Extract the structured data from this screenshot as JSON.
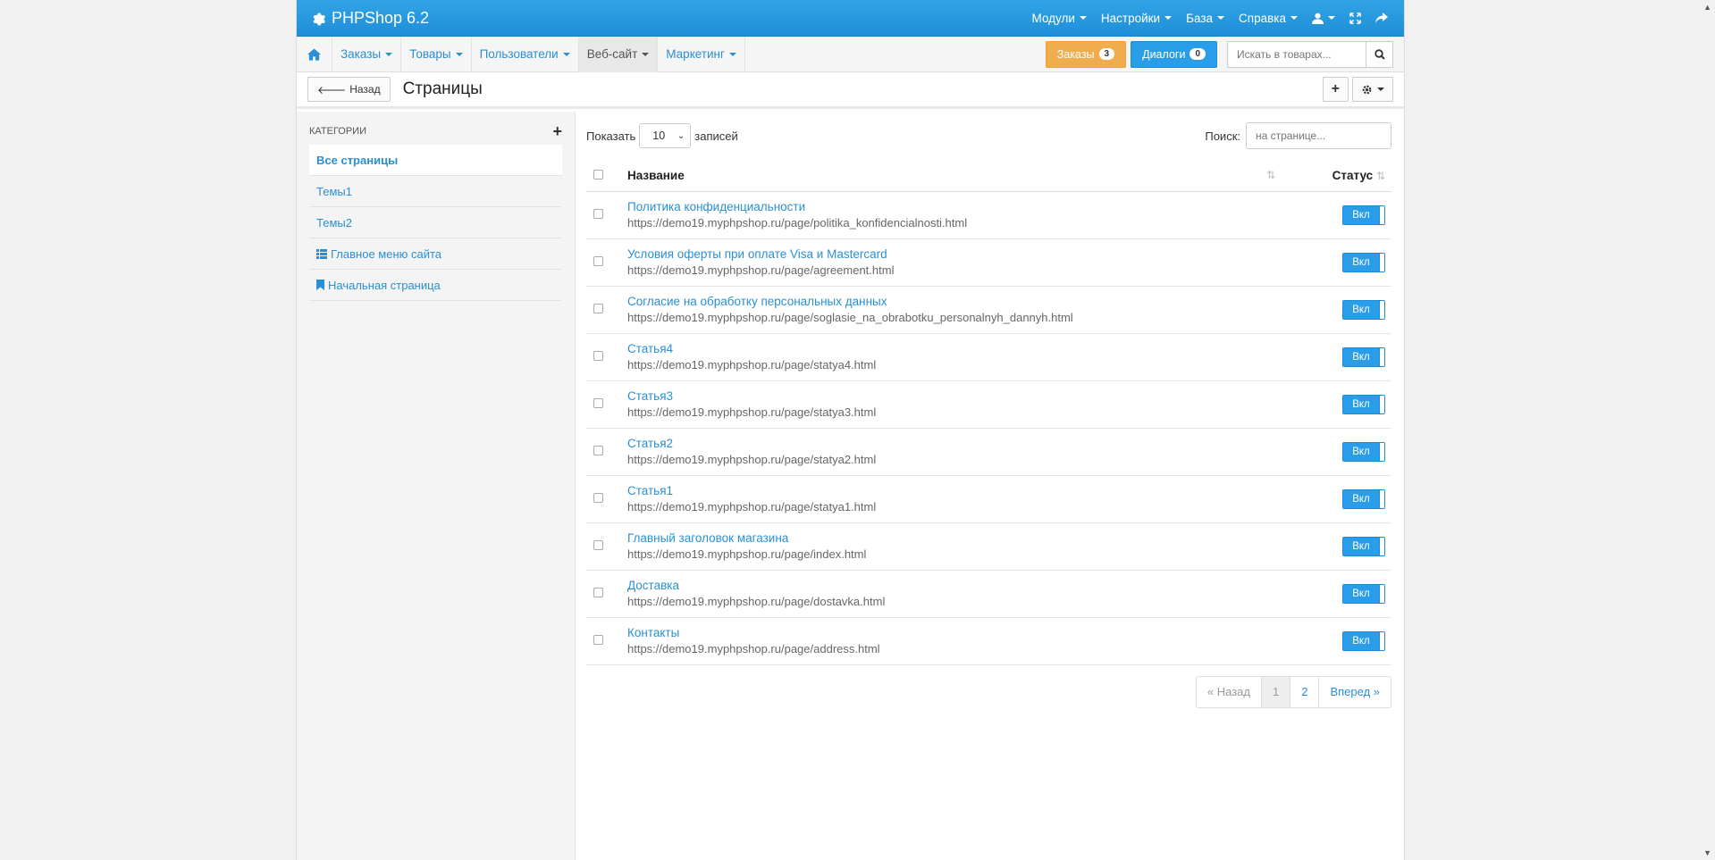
{
  "app": {
    "brand": "PHPShop 6.2",
    "top_menu": [
      "Модули",
      "Настройки",
      "База",
      "Справка"
    ]
  },
  "subnav": {
    "items": [
      {
        "label": "Заказы",
        "active": false
      },
      {
        "label": "Товары",
        "active": false
      },
      {
        "label": "Пользователи",
        "active": false
      },
      {
        "label": "Веб-сайт",
        "active": true
      },
      {
        "label": "Маркетинг",
        "active": false
      }
    ],
    "orders_label": "Заказы",
    "orders_count": "3",
    "dialogs_label": "Диалоги",
    "dialogs_count": "0",
    "search_placeholder": "Искать в товарах..."
  },
  "page": {
    "back_label": "Назад",
    "title": "Страницы"
  },
  "sidebar": {
    "heading": "Категории",
    "items": [
      {
        "label": "Все страницы",
        "icon": "",
        "active": true
      },
      {
        "label": "Темы1",
        "icon": "",
        "active": false
      },
      {
        "label": "Темы2",
        "icon": "",
        "active": false
      },
      {
        "label": "Главное меню сайта",
        "icon": "list-icon",
        "active": false
      },
      {
        "label": "Начальная страница",
        "icon": "bookmark-icon",
        "active": false
      }
    ]
  },
  "table": {
    "show_label": "Показать",
    "page_size": "10",
    "records_label": "записей",
    "search_label": "Поиск:",
    "search_placeholder": "на странице...",
    "col_name": "Название",
    "col_status": "Статус",
    "rows": [
      {
        "title": "Политика конфиденциальности",
        "url": "https://demo19.myphpshop.ru/page/politika_konfidencialnosti.html",
        "status": "Вкл"
      },
      {
        "title": "Условия оферты при оплате Visa и Mastercard",
        "url": "https://demo19.myphpshop.ru/page/agreement.html",
        "status": "Вкл"
      },
      {
        "title": "Согласие на обработку персональных данных",
        "url": "https://demo19.myphpshop.ru/page/soglasie_na_obrabotku_personalnyh_dannyh.html",
        "status": "Вкл"
      },
      {
        "title": "Статья4",
        "url": "https://demo19.myphpshop.ru/page/statya4.html",
        "status": "Вкл"
      },
      {
        "title": "Статья3",
        "url": "https://demo19.myphpshop.ru/page/statya3.html",
        "status": "Вкл"
      },
      {
        "title": "Статья2",
        "url": "https://demo19.myphpshop.ru/page/statya2.html",
        "status": "Вкл"
      },
      {
        "title": "Статья1",
        "url": "https://demo19.myphpshop.ru/page/statya1.html",
        "status": "Вкл"
      },
      {
        "title": "Главный заголовок магазина",
        "url": "https://demo19.myphpshop.ru/page/index.html",
        "status": "Вкл"
      },
      {
        "title": "Доставка",
        "url": "https://demo19.myphpshop.ru/page/dostavka.html",
        "status": "Вкл"
      },
      {
        "title": "Контакты",
        "url": "https://demo19.myphpshop.ru/page/address.html",
        "status": "Вкл"
      }
    ]
  },
  "pagination": {
    "prev": "« Назад",
    "pages": [
      "1",
      "2"
    ],
    "current": "1",
    "next": "Вперед »"
  },
  "colors": {
    "primary": "#2a9de8",
    "link": "#2a8fd4",
    "warning": "#f0ad4e"
  }
}
